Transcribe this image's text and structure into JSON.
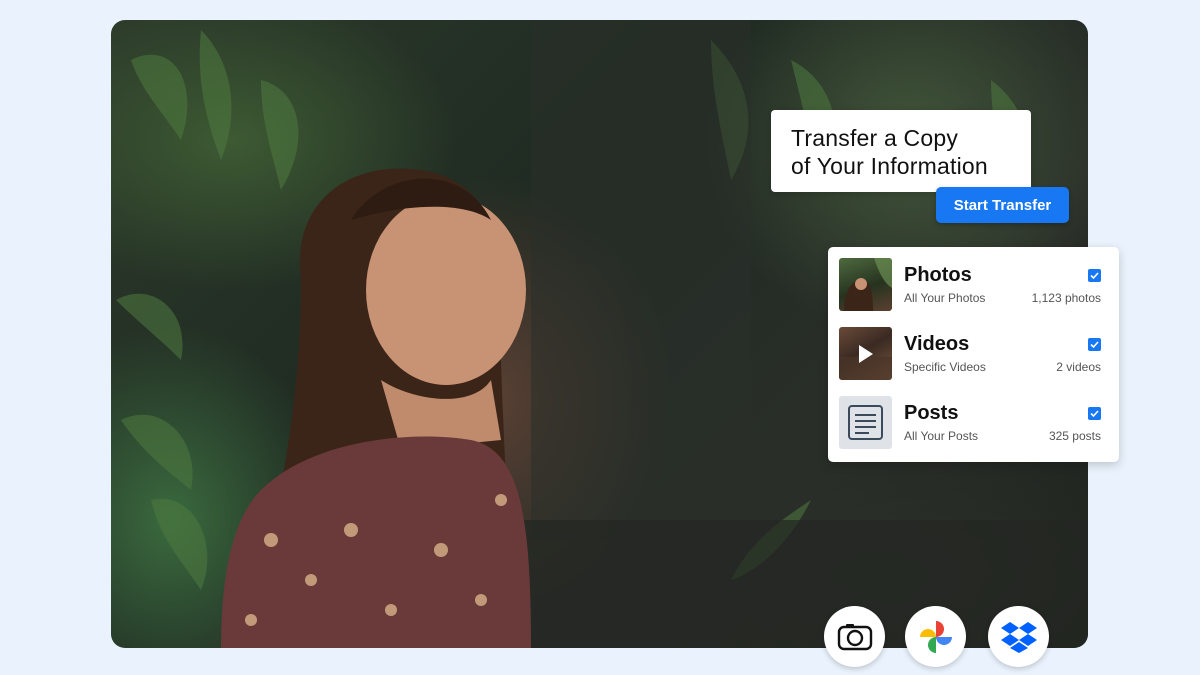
{
  "hero": {
    "image": "woman-in-garden-photo"
  },
  "transfer": {
    "title_line1": "Transfer a Copy",
    "title_line2": "of Your Information",
    "button_label": "Start Transfer"
  },
  "media": {
    "items": [
      {
        "name": "Photos",
        "scope": "All Your Photos",
        "count": "1,123 photos",
        "checked": true,
        "thumb": "photo-thumbnail"
      },
      {
        "name": "Videos",
        "scope": "Specific Videos",
        "count": "2 videos",
        "checked": true,
        "thumb": "video-thumbnail"
      },
      {
        "name": "Posts",
        "scope": "All Your Posts",
        "count": "325 posts",
        "checked": true,
        "thumb": "document-icon"
      }
    ]
  },
  "destinations": [
    {
      "icon": "photobucket-icon"
    },
    {
      "icon": "google-photos-icon"
    },
    {
      "icon": "dropbox-icon"
    }
  ],
  "colors": {
    "accent": "#1877f2",
    "background": "#eaf3fd"
  }
}
